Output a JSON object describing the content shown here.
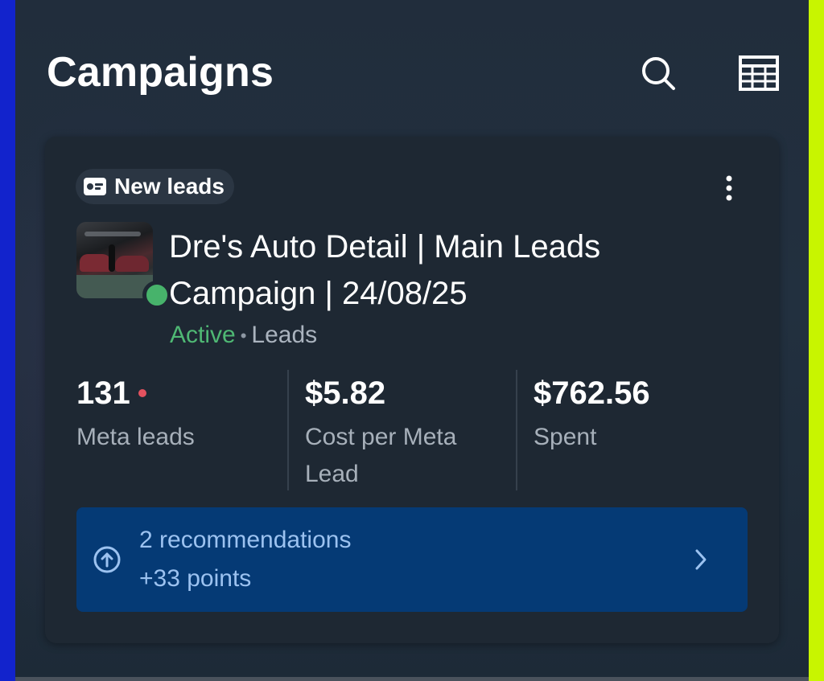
{
  "header": {
    "title": "Campaigns",
    "search_icon": "search-icon",
    "table_icon": "table-view-icon"
  },
  "campaign": {
    "badge_icon": "lead-card-icon",
    "badge_label": "New leads",
    "name": "Dre's Auto Detail | Main Leads Campaign | 24/08/25",
    "status": "Active",
    "status_color": "#4fb874",
    "objective": "Leads",
    "metrics": [
      {
        "value": "131",
        "label": "Meta leads",
        "indicator_color": "#e4525f"
      },
      {
        "value": "$5.82",
        "label": "Cost per Meta Lead"
      },
      {
        "value": "$762.56",
        "label": "Spent"
      }
    ],
    "recommendations": {
      "title": "2 recommendations",
      "points": "+33 points",
      "icon": "arrow-up-circle-icon",
      "chevron": "chevron-right-icon"
    }
  }
}
